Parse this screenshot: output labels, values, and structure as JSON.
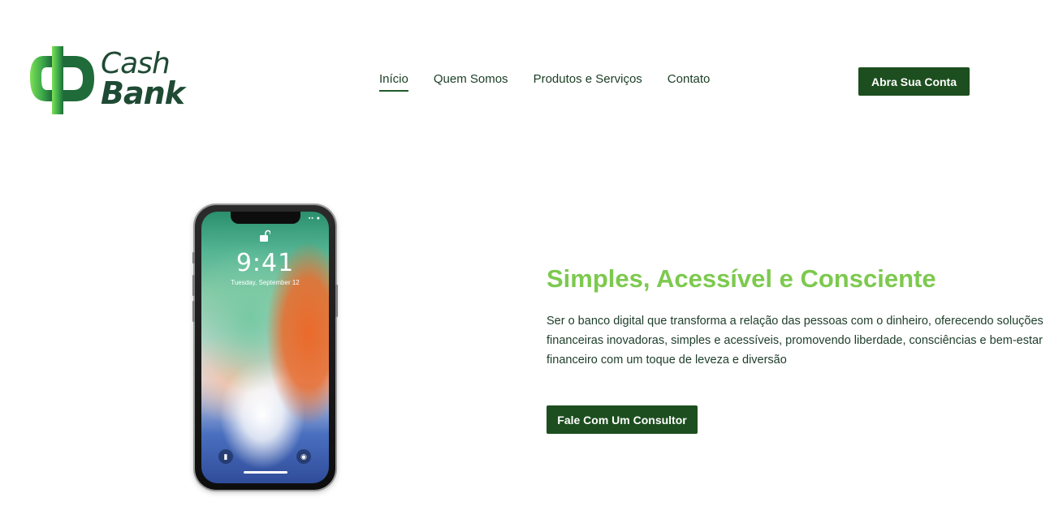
{
  "brand": {
    "name_line1": "Cash",
    "name_line2": "Bank",
    "colors": {
      "dark_green": "#1d4e1f",
      "light_green": "#7dc94f",
      "logo_text": "#1f4a34"
    }
  },
  "nav": {
    "items": [
      {
        "label": "Início",
        "active": true
      },
      {
        "label": "Quem Somos",
        "active": false
      },
      {
        "label": "Produtos e Serviços",
        "active": false
      },
      {
        "label": "Contato",
        "active": false
      }
    ]
  },
  "header": {
    "cta_label": "Abra Sua Conta"
  },
  "phone_screen": {
    "time": "9:41",
    "date": "Tuesday, September 12",
    "icons": [
      "lock-open-icon",
      "flashlight-icon",
      "camera-icon"
    ]
  },
  "hero": {
    "title": "Simples, Acessível e Consciente",
    "description": "Ser o banco digital que transforma a relação das pessoas com o dinheiro, oferecendo soluções financeiras inovadoras, simples e acessíveis, promovendo liberdade, consciências e bem-estar financeiro com um toque de leveza e diversão",
    "cta_label": "Fale Com Um Consultor"
  }
}
